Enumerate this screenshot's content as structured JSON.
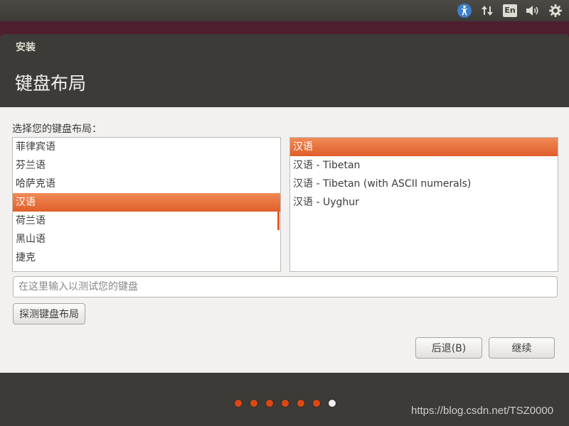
{
  "top_panel": {
    "indicators": [
      {
        "name": "accessibility-icon"
      },
      {
        "name": "network-icon"
      },
      {
        "name": "keyboard-language-icon",
        "label": "En"
      },
      {
        "name": "volume-icon"
      },
      {
        "name": "settings-gear-icon"
      }
    ]
  },
  "window": {
    "title": "安装",
    "heading": "键盘布局"
  },
  "content": {
    "prompt": "选择您的键盘布局：",
    "layouts": [
      "菲律宾语",
      "芬兰语",
      "哈萨克语",
      "汉语",
      "荷兰语",
      "黑山语",
      "捷克"
    ],
    "selected_layout": "汉语",
    "variants": [
      "汉语",
      "汉语 - Tibetan",
      "汉语 - Tibetan (with ASCII numerals)",
      "汉语 - Uyghur"
    ],
    "selected_variant": "汉语",
    "test_input": {
      "value": "",
      "placeholder": "在这里输入以测试您的键盘"
    },
    "detect_button": "探测键盘布局"
  },
  "actions": {
    "back_button": "后退(B)",
    "continue_button": "继续"
  },
  "progress": {
    "total_steps": 7,
    "current_step": 7
  },
  "watermark": "https://blog.csdn.net/TSZ0000",
  "colors": {
    "accent": "#e05e2a",
    "window_bg": "#3c3b37",
    "content_bg": "#f2f1f0"
  }
}
